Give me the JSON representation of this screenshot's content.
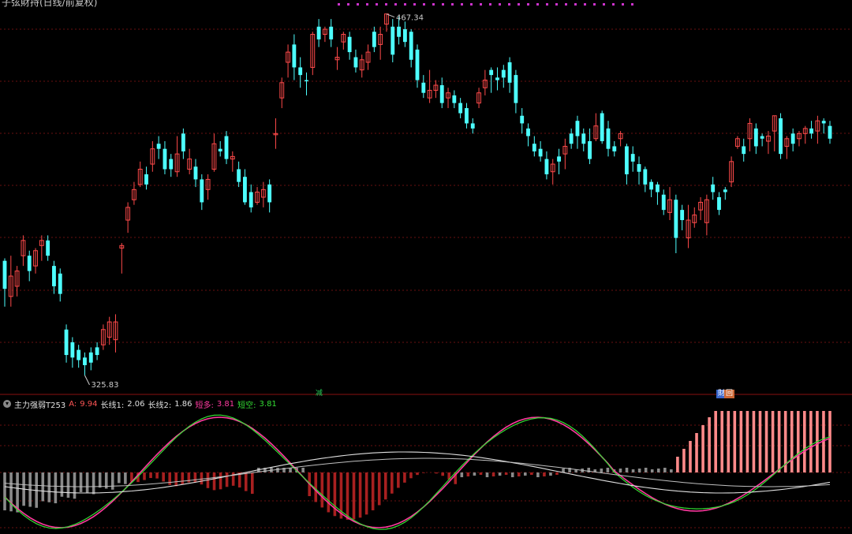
{
  "header": {
    "title": "子弦財持(日线/前复权)"
  },
  "price_labels": {
    "high": "467.34",
    "low": "325.83"
  },
  "indicator": {
    "name": "主力强弱T253",
    "items": [
      {
        "label": "A:",
        "value": "9.94",
        "color": "#ff5555"
      },
      {
        "label": "长线1:",
        "value": "2.06",
        "color": "#e0e0e0"
      },
      {
        "label": "长线2:",
        "value": "1.86",
        "color": "#e0e0e0"
      },
      {
        "label": "短多:",
        "value": "3.81",
        "color": "#ff3aa0"
      },
      {
        "label": "短空:",
        "value": "3.81",
        "color": "#33dd33"
      }
    ],
    "dropdown_icon": "chevron-down-icon"
  },
  "markers": [
    {
      "text": "减",
      "color": "#22cc55",
      "bg": "#1a1a1a"
    },
    {
      "text": "財",
      "color": "#ffffff",
      "bg": "#3a66cc"
    },
    {
      "text": "回",
      "color": "#ffffff",
      "bg": "#cc6633"
    }
  ],
  "colors": {
    "up": "#ff4a4a",
    "down": "#4dffff",
    "grid": "#6a1010",
    "pink_bar": "#ff8a8a",
    "red_bar": "#a82020",
    "gray_bar": "#8a8a8a",
    "line_pink": "#ff3aa0",
    "line_green": "#33dd33",
    "line_white": "#e0e0e0"
  },
  "chart_data": {
    "type": "candlestick",
    "ylim": [
      320,
      470
    ],
    "candles": [
      [
        359,
        370,
        352,
        371,
        "d"
      ],
      [
        356,
        364,
        352,
        372,
        "u"
      ],
      [
        360,
        366,
        356,
        368,
        "u"
      ],
      [
        372,
        378,
        368,
        380,
        "u"
      ],
      [
        372,
        366,
        362,
        374,
        "d"
      ],
      [
        368,
        374,
        365,
        375,
        "u"
      ],
      [
        376,
        378,
        370,
        380,
        "u"
      ],
      [
        378,
        372,
        370,
        380,
        "d"
      ],
      [
        368,
        360,
        357,
        370,
        "d"
      ],
      [
        365,
        357,
        354,
        367,
        "d"
      ],
      [
        343,
        333,
        330,
        345,
        "d"
      ],
      [
        338,
        332,
        328,
        340,
        "d"
      ],
      [
        335,
        331,
        328,
        337,
        "d"
      ],
      [
        332,
        329,
        325,
        334,
        "d"
      ],
      [
        334,
        330,
        327,
        336,
        "d"
      ],
      [
        336,
        333,
        331,
        338,
        "d"
      ],
      [
        337,
        343,
        335,
        345,
        "u"
      ],
      [
        340,
        346,
        337,
        348,
        "u"
      ],
      [
        339,
        346,
        334,
        349,
        "u"
      ],
      [
        375,
        376,
        365,
        377,
        "u"
      ],
      [
        386,
        391,
        381,
        393,
        "u"
      ],
      [
        394,
        398,
        392,
        401,
        "u"
      ],
      [
        400,
        406,
        399,
        409,
        "u"
      ],
      [
        404,
        400,
        398,
        407,
        "d"
      ],
      [
        408,
        414,
        405,
        417,
        "u"
      ],
      [
        416,
        414,
        410,
        419,
        "d"
      ],
      [
        414,
        406,
        404,
        417,
        "d"
      ],
      [
        410,
        406,
        403,
        412,
        "d"
      ],
      [
        405,
        412,
        403,
        419,
        "u"
      ],
      [
        420,
        413,
        410,
        422,
        "d"
      ],
      [
        406,
        410,
        404,
        414,
        "u"
      ],
      [
        407,
        402,
        399,
        410,
        "d"
      ],
      [
        402,
        393,
        390,
        404,
        "d"
      ],
      [
        398,
        402,
        394,
        404,
        "u"
      ],
      [
        406,
        416,
        405,
        420,
        "u"
      ],
      [
        414,
        413,
        411,
        417,
        "d"
      ],
      [
        419,
        410,
        408,
        421,
        "d"
      ],
      [
        410,
        411,
        405,
        413,
        "u"
      ],
      [
        406,
        401,
        399,
        409,
        "d"
      ],
      [
        403,
        393,
        392,
        406,
        "d"
      ],
      [
        397,
        391,
        389,
        400,
        "d"
      ],
      [
        393,
        397,
        392,
        399,
        "u"
      ],
      [
        395,
        398,
        391,
        401,
        "u"
      ],
      [
        400,
        393,
        389,
        402,
        "d"
      ],
      [
        420,
        420,
        414,
        426,
        "u"
      ],
      [
        434,
        440,
        430,
        442,
        "u"
      ],
      [
        448,
        452,
        442,
        455,
        "u"
      ],
      [
        455,
        446,
        441,
        459,
        "d"
      ],
      [
        446,
        443,
        438,
        450,
        "d"
      ],
      [
        441,
        441,
        435,
        444,
        "d"
      ],
      [
        446,
        459,
        443,
        460,
        "u"
      ],
      [
        462,
        457,
        454,
        465,
        "d"
      ],
      [
        459,
        461,
        456,
        462,
        "u"
      ],
      [
        462,
        457,
        454,
        465,
        "d"
      ],
      [
        449,
        450,
        445,
        454,
        "u"
      ],
      [
        456,
        459,
        453,
        460,
        "u"
      ],
      [
        458,
        452,
        449,
        460,
        "d"
      ],
      [
        450,
        446,
        444,
        453,
        "d"
      ],
      [
        445,
        449,
        442,
        451,
        "u"
      ],
      [
        448,
        452,
        445,
        455,
        "u"
      ],
      [
        460,
        454,
        452,
        462,
        "d"
      ],
      [
        455,
        459,
        449,
        462,
        "u"
      ],
      [
        463,
        467,
        460,
        467,
        "u"
      ],
      [
        462,
        451,
        448,
        465,
        "d"
      ],
      [
        462,
        458,
        455,
        466,
        "d"
      ],
      [
        461,
        456,
        454,
        464,
        "d"
      ],
      [
        460,
        449,
        446,
        461,
        "d"
      ],
      [
        453,
        441,
        438,
        455,
        "d"
      ],
      [
        440,
        436,
        434,
        443,
        "d"
      ],
      [
        434,
        437,
        432,
        445,
        "u"
      ],
      [
        437,
        439,
        434,
        441,
        "u"
      ],
      [
        439,
        432,
        430,
        442,
        "d"
      ],
      [
        434,
        436,
        430,
        438,
        "u"
      ],
      [
        435,
        432,
        430,
        437,
        "d"
      ],
      [
        432,
        428,
        426,
        434,
        "d"
      ],
      [
        430,
        424,
        422,
        432,
        "d"
      ],
      [
        424,
        422,
        420,
        426,
        "d"
      ],
      [
        432,
        436,
        430,
        438,
        "u"
      ],
      [
        441,
        438,
        435,
        445,
        "u"
      ],
      [
        445,
        443,
        436,
        446,
        "d"
      ],
      [
        442,
        441,
        437,
        446,
        "d"
      ],
      [
        445,
        442,
        438,
        447,
        "d"
      ],
      [
        448,
        440,
        436,
        450,
        "d"
      ],
      [
        443,
        432,
        428,
        445,
        "d"
      ],
      [
        427,
        424,
        420,
        430,
        "d"
      ],
      [
        422,
        419,
        415,
        424,
        "d"
      ],
      [
        416,
        413,
        411,
        419,
        "d"
      ],
      [
        414,
        411,
        409,
        417,
        "d"
      ],
      [
        410,
        404,
        402,
        413,
        "d"
      ],
      [
        405,
        408,
        400,
        410,
        "u"
      ],
      [
        411,
        409,
        404,
        414,
        "d"
      ],
      [
        412,
        415,
        406,
        418,
        "u"
      ],
      [
        420,
        416,
        414,
        422,
        "d"
      ],
      [
        425,
        419,
        414,
        427,
        "d"
      ],
      [
        420,
        416,
        413,
        422,
        "d"
      ],
      [
        417,
        410,
        408,
        422,
        "d"
      ],
      [
        418,
        423,
        417,
        428,
        "u"
      ],
      [
        428,
        417,
        416,
        429,
        "d"
      ],
      [
        422,
        414,
        411,
        425,
        "d"
      ],
      [
        415,
        413,
        411,
        417,
        "d"
      ],
      [
        418,
        420,
        415,
        421,
        "u"
      ],
      [
        415,
        404,
        400,
        416,
        "d"
      ],
      [
        412,
        409,
        405,
        415,
        "d"
      ],
      [
        408,
        405,
        400,
        411,
        "d"
      ],
      [
        406,
        400,
        397,
        407,
        "d"
      ],
      [
        401,
        398,
        395,
        402,
        "d"
      ],
      [
        400,
        397,
        392,
        401,
        "d"
      ],
      [
        396,
        390,
        388,
        398,
        "d"
      ],
      [
        394,
        389,
        386,
        399,
        "u"
      ],
      [
        394,
        379,
        373,
        396,
        "d"
      ],
      [
        390,
        386,
        382,
        392,
        "d"
      ],
      [
        379,
        386,
        375,
        392,
        "u"
      ],
      [
        385,
        388,
        383,
        391,
        "u"
      ],
      [
        390,
        393,
        386,
        395,
        "u"
      ],
      [
        385,
        394,
        380,
        396,
        "u"
      ],
      [
        400,
        397,
        394,
        403,
        "d"
      ],
      [
        395,
        390,
        388,
        397,
        "d"
      ],
      [
        398,
        397,
        394,
        399,
        "d"
      ],
      [
        401,
        409,
        399,
        411,
        "u"
      ],
      [
        415,
        418,
        414,
        419,
        "u"
      ],
      [
        415,
        412,
        409,
        418,
        "d"
      ],
      [
        418,
        424,
        413,
        426,
        "u"
      ],
      [
        422,
        415,
        412,
        424,
        "d"
      ],
      [
        419,
        418,
        415,
        420,
        "d"
      ],
      [
        417,
        419,
        412,
        421,
        "u"
      ],
      [
        421,
        427,
        413,
        427,
        "u"
      ],
      [
        426,
        412,
        410,
        428,
        "d"
      ],
      [
        415,
        418,
        410,
        419,
        "u"
      ],
      [
        420,
        416,
        413,
        422,
        "d"
      ],
      [
        418,
        420,
        415,
        421,
        "u"
      ],
      [
        420,
        422,
        416,
        423,
        "u"
      ],
      [
        422,
        420,
        418,
        425,
        "d"
      ],
      [
        421,
        425,
        416,
        427,
        "u"
      ],
      [
        424,
        425,
        420,
        426,
        "d"
      ],
      [
        423,
        418,
        416,
        425,
        "d"
      ]
    ],
    "annotations": [
      {
        "text": "467.34",
        "at": "high"
      },
      {
        "text": "325.83",
        "at": "low"
      }
    ]
  }
}
